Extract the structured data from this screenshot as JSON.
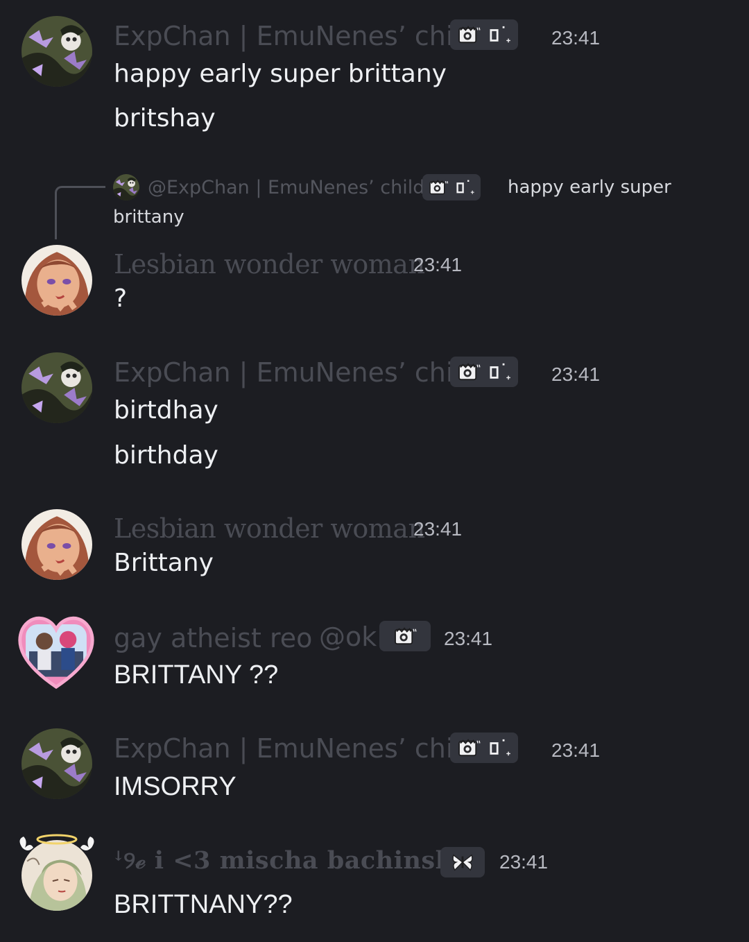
{
  "messages": [
    {
      "author": "ExpChan | EmuNenes’ child",
      "time": "23:41",
      "lines": [
        "happy early super brittany",
        "britshay"
      ]
    },
    {
      "reply": {
        "mention": "@ExpChan | EmuNenes’ child",
        "snippet_line1": "happy early super",
        "snippet_line2": "brittany"
      },
      "author": "Lesbian wonder woman",
      "time": "23:41",
      "lines": [
        "?"
      ]
    },
    {
      "author": "ExpChan | EmuNenes’ child",
      "time": "23:41",
      "lines": [
        "birtdhay",
        "birthday"
      ]
    },
    {
      "author": "Lesbian wonder woman",
      "time": "23:41",
      "lines": [
        "Brittany"
      ]
    },
    {
      "author": "gay atheist reo",
      "author_tag": "@ok",
      "time": "23:41",
      "lines": [
        "BRITTANY ??"
      ]
    },
    {
      "author": "ExpChan | EmuNenes’ child",
      "time": "23:41",
      "lines": [
        "IMSORRY"
      ]
    },
    {
      "author": "ꜜ୨ℯ i <3 mischa bachinski",
      "time": "23:41",
      "lines": [
        "BRITTNANY??"
      ]
    }
  ],
  "icons": {
    "badge_crown": "crown-badge-icon",
    "badge_box": "box-badge-icon",
    "badge_butterfly": "butterfly-badge-icon"
  },
  "colors": {
    "background": "#1c1d22",
    "username": "#4a4c54",
    "message_text": "#eef0f3",
    "timestamp": "#b7b9c1",
    "badge_bg": "#33353d"
  }
}
